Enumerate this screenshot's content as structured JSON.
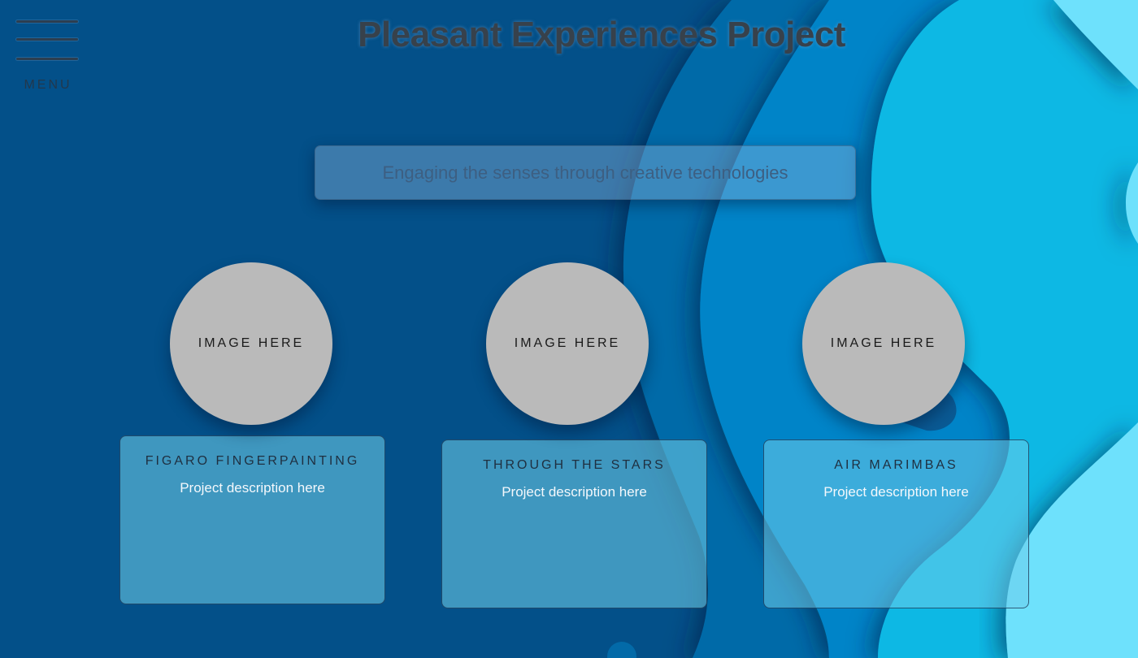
{
  "header": {
    "menu_label": "MENU",
    "title": "Pleasant Experiences Project"
  },
  "hero": {
    "tagline": "Engaging the senses through creative technologies"
  },
  "projects": [
    {
      "image_placeholder": "IMAGE HERE",
      "name": "FIGARO FINGERPAINTING",
      "description": "Project description here"
    },
    {
      "image_placeholder": "IMAGE HERE",
      "name": "THROUGH THE STARS",
      "description": "Project description here"
    },
    {
      "image_placeholder": "IMAGE HERE",
      "name": "AIR MARIMBAS",
      "description": "Project description here"
    }
  ],
  "colors": {
    "background": "#035089",
    "wave_mid": "#0384c8",
    "wave_light": "#0ab8e4",
    "wave_lightest": "#6ee1fc",
    "placeholder_circle": "#bababa",
    "title_text": "#37414b"
  },
  "icons": {
    "menu": "hamburger-menu-icon"
  }
}
